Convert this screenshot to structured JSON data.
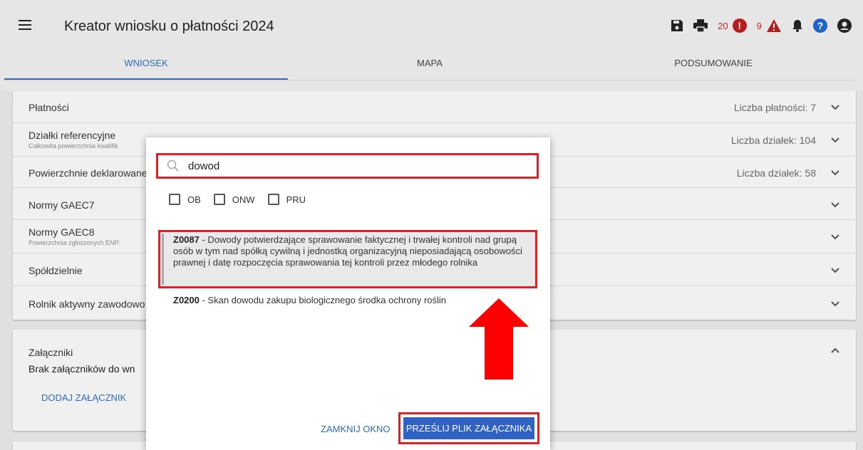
{
  "header": {
    "title": "Kreator wniosku o płatności 2024",
    "errors_count": "20",
    "warnings_count": "9"
  },
  "tabs": [
    {
      "label": "WNIOSEK",
      "active": true
    },
    {
      "label": "MAPA",
      "active": false
    },
    {
      "label": "PODSUMOWANIE",
      "active": false
    }
  ],
  "sections": [
    {
      "label": "Płatności",
      "sub": "",
      "right": "Liczba płatności: 7"
    },
    {
      "label": "Działki referencyjne",
      "sub": "Całkowita powierzchnia kwalifik",
      "right": "Liczba działek: 104"
    },
    {
      "label": "Powierzchnie deklarowane",
      "sub": "",
      "right": "Liczba działek: 58"
    },
    {
      "label": "Normy GAEC7",
      "sub": "",
      "right": ""
    },
    {
      "label": "Normy GAEC8",
      "sub": "Powierzchnia zgłoszonych ENP:",
      "right": ""
    },
    {
      "label": "Spółdzielnie",
      "sub": "",
      "right": ""
    },
    {
      "label": "Rolnik aktywny zawodowo",
      "sub": "",
      "right": ""
    }
  ],
  "attachments": {
    "title": "Załączniki",
    "empty": "Brak załączników do wn",
    "add": "DODAJ ZAŁĄCZNIK"
  },
  "modal": {
    "search_value": "dowod",
    "filters": [
      "OB",
      "ONW",
      "PRU"
    ],
    "results": [
      {
        "code": "Z0087",
        "text": " - Dowody potwierdzające sprawowanie faktycznej i trwałej kontroli nad grupą osób w tym nad spółką cywilną i jednostką organizacyjną nieposiadającą osobowości prawnej i datę rozpoczęcia sprawowania tej kontroli przez młodego rolnika"
      },
      {
        "code": "Z0200",
        "text": " - Skan dowodu zakupu biologicznego środka ochrony roślin"
      }
    ],
    "close_label": "ZAMKNIJ OKNO",
    "send_label": "PRZEŚLIJ PLIK ZAŁĄCZNIKA"
  },
  "colors": {
    "accent": "#2f6bbf",
    "highlight": "#e31e24",
    "error": "#b71c1c"
  }
}
